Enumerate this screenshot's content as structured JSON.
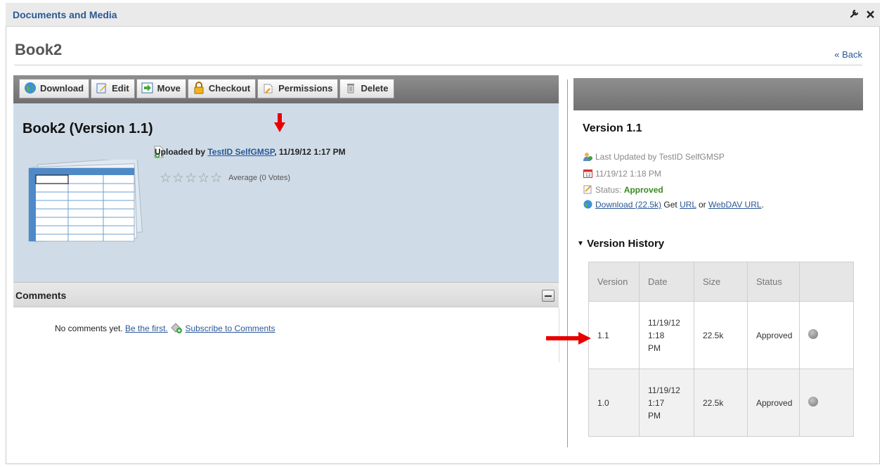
{
  "portlet": {
    "title": "Documents and Media",
    "config_icon": "wrench-icon",
    "close_icon": "close-icon"
  },
  "document": {
    "title": "Book2",
    "back_label": "« Back",
    "version_heading": "Book2 (Version 1.1)",
    "uploaded_prefix": "Uploaded by ",
    "uploaded_user": "TestID SelfGMSP",
    "uploaded_suffix": ", 11/19/12 1:17 PM",
    "rating": {
      "stars_filled": 0,
      "stars_total": 5,
      "label": "Average (0 Votes)"
    }
  },
  "toolbar": {
    "download": "Download",
    "edit": "Edit",
    "move": "Move",
    "checkout": "Checkout",
    "permissions": "Permissions",
    "delete": "Delete"
  },
  "comments": {
    "title": "Comments",
    "empty_text": "No comments yet.",
    "be_first": "Be the first.",
    "subscribe": "Subscribe to Comments"
  },
  "details": {
    "version_title": "Version 1.1",
    "last_updated": "Last Updated by TestID SelfGMSP",
    "date": "11/19/12 1:18 PM",
    "status_label": "Status: ",
    "status_value": "Approved",
    "download_link": "Download (22.5k)",
    "get_text": " Get ",
    "url_link": "URL",
    "or_text": " or ",
    "webdav_link": "WebDAV URL",
    "period": "."
  },
  "version_history": {
    "title": "Version History",
    "columns": [
      "Version",
      "Date",
      "Size",
      "Status"
    ],
    "rows": [
      {
        "version": "1.1",
        "date": "11/19/12 1:18 PM",
        "size": "22.5k",
        "status": "Approved"
      },
      {
        "version": "1.0",
        "date": "11/19/12 1:17 PM",
        "size": "22.5k",
        "status": "Approved"
      }
    ]
  },
  "colors": {
    "link": "#2a5896",
    "approved": "#3a8a1f",
    "arrow": "#e80000",
    "panel_bg": "#cfdce8"
  }
}
